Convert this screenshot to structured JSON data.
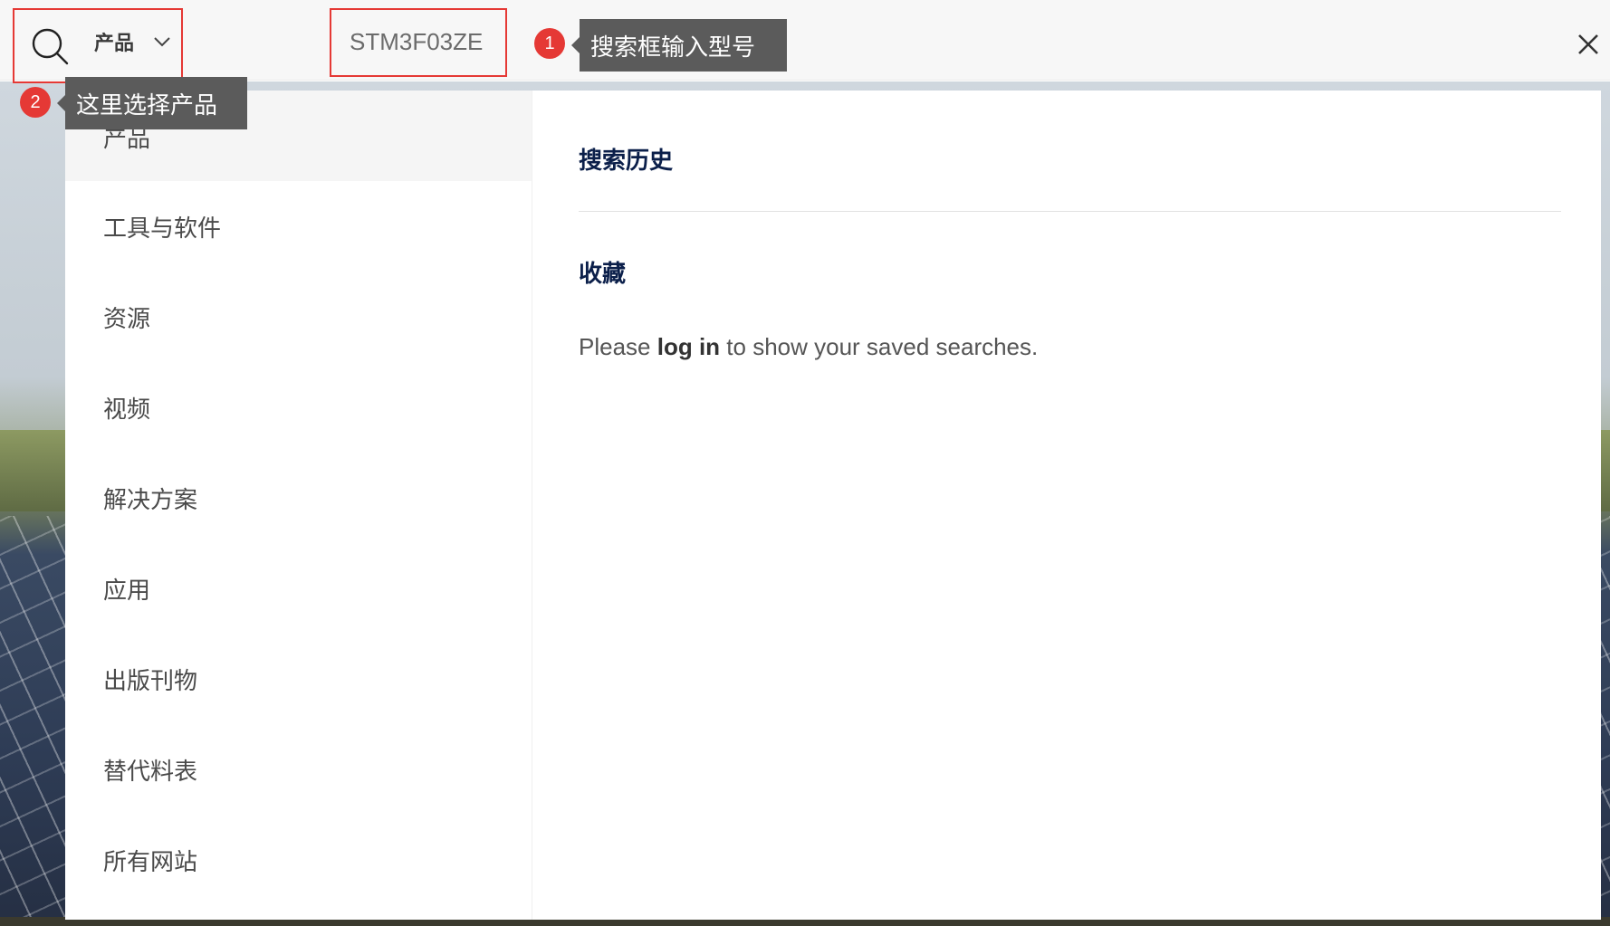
{
  "search": {
    "category_label": "产品",
    "query_value": "STM3F03ZE",
    "icon": "search-icon"
  },
  "annotations": [
    {
      "number": "1",
      "text": "搜索框输入型号"
    },
    {
      "number": "2",
      "text": "这里选择产品"
    }
  ],
  "categories": [
    {
      "label": "产品",
      "active": true
    },
    {
      "label": "工具与软件"
    },
    {
      "label": "资源"
    },
    {
      "label": "视频"
    },
    {
      "label": "解决方案"
    },
    {
      "label": "应用"
    },
    {
      "label": "出版刊物"
    },
    {
      "label": "替代料表"
    },
    {
      "label": "所有网站"
    }
  ],
  "right_pane": {
    "history_title": "搜索历史",
    "favorites_title": "收藏",
    "login_prefix": "Please ",
    "login_link": "log in",
    "login_suffix": " to show your saved searches."
  },
  "colors": {
    "accent_red": "#e53935",
    "title_navy": "#0b1f4a",
    "tooltip_gray": "#5b5b5b"
  }
}
